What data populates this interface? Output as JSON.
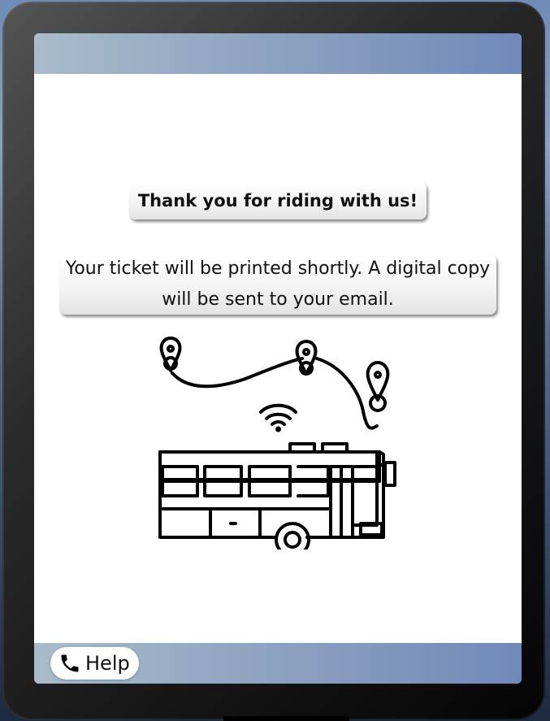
{
  "screen": {
    "thank_you": "Thank you for riding with us!",
    "ticket_message": "Your ticket will be printed shortly. A digital copy will be sent to your email."
  },
  "illustration": {
    "icons": [
      "map-pin-icon",
      "route-path-icon",
      "wifi-icon",
      "bus-icon"
    ]
  },
  "footer": {
    "help_label": "Help",
    "help_icon": "phone-icon"
  },
  "colors": {
    "bar_gradient_start": "#a9bccb",
    "bar_gradient_end": "#7189b9",
    "device_frame": "#2b2b2b",
    "text": "#111111"
  }
}
